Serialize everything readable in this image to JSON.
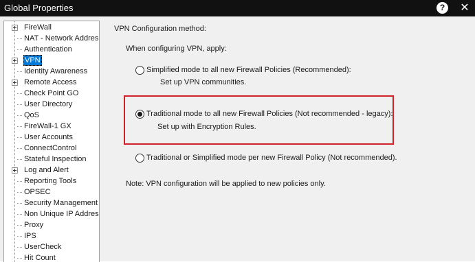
{
  "window": {
    "title": "Global Properties",
    "help_label": "?",
    "close_label": "✕"
  },
  "tree": {
    "items": [
      {
        "label": "FireWall",
        "expandable": true
      },
      {
        "label": "NAT - Network Addres",
        "expandable": false
      },
      {
        "label": "Authentication",
        "expandable": false
      },
      {
        "label": "VPN",
        "expandable": true,
        "selected": true
      },
      {
        "label": "Identity Awareness",
        "expandable": false
      },
      {
        "label": "Remote Access",
        "expandable": true
      },
      {
        "label": "Check Point GO",
        "expandable": false
      },
      {
        "label": "User Directory",
        "expandable": false
      },
      {
        "label": "QoS",
        "expandable": false
      },
      {
        "label": "FireWall-1 GX",
        "expandable": false
      },
      {
        "label": "User Accounts",
        "expandable": false
      },
      {
        "label": "ConnectControl",
        "expandable": false
      },
      {
        "label": "Stateful Inspection",
        "expandable": false
      },
      {
        "label": "Log and Alert",
        "expandable": true
      },
      {
        "label": "Reporting Tools",
        "expandable": false
      },
      {
        "label": "OPSEC",
        "expandable": false
      },
      {
        "label": "Security Management .",
        "expandable": false
      },
      {
        "label": "Non Unique IP Address",
        "expandable": false
      },
      {
        "label": "Proxy",
        "expandable": false
      },
      {
        "label": "IPS",
        "expandable": false
      },
      {
        "label": "UserCheck",
        "expandable": false
      },
      {
        "label": "Hit Count",
        "expandable": false
      }
    ]
  },
  "vpn": {
    "section_title": "VPN Configuration method:",
    "apply_label": "When configuring VPN, apply:",
    "options": [
      {
        "label": "Simplified mode to all new Firewall Policies (Recommended):",
        "description": "Set up VPN communities.",
        "checked": false
      },
      {
        "label": "Traditional mode to all new Firewall Policies (Not recommended - legacy):",
        "description": "Set up with Encryption Rules.",
        "checked": true
      },
      {
        "label": "Traditional or Simplified mode per new Firewall Policy (Not recommended).",
        "description": "",
        "checked": false
      }
    ],
    "note": "Note: VPN configuration will be applied to new policies only."
  },
  "colors": {
    "highlight_border": "#d0212a",
    "selection": "#0078d7",
    "titlebar": "#111111"
  }
}
